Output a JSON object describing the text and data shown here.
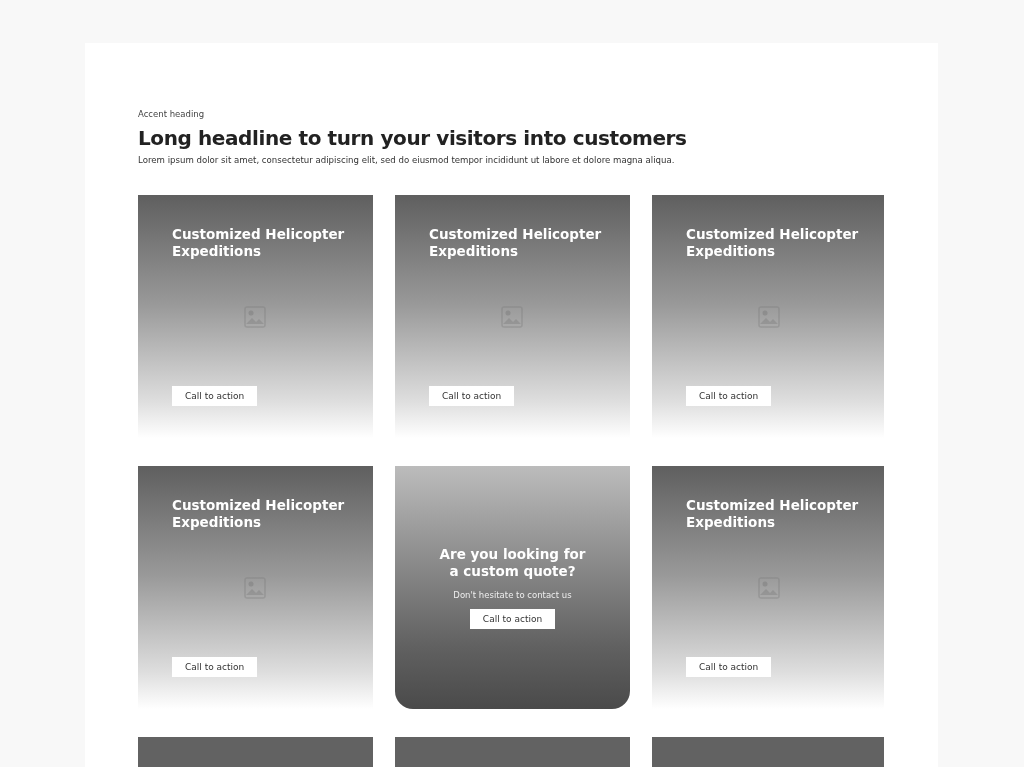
{
  "section": {
    "eyebrow": "Accent heading",
    "headline": "Long headline to turn your visitors into customers",
    "lead": "Lorem ipsum dolor sit amet, consectetur adipiscing elit, sed do eiusmod tempor incididunt ut labore et dolore magna aliqua."
  },
  "cards": [
    {
      "kind": "feature",
      "title": "Customized Helicopter Expeditions",
      "button": "Call to action"
    },
    {
      "kind": "feature",
      "title": "Customized Helicopter Expeditions",
      "button": "Call to action"
    },
    {
      "kind": "feature",
      "title": "Customized Helicopter Expeditions",
      "button": "Call to action"
    },
    {
      "kind": "feature",
      "title": "Customized Helicopter Expeditions",
      "button": "Call to action"
    },
    {
      "kind": "quote",
      "title": "Are you looking for a custom quote?",
      "text": "Don't hesitate to contact us",
      "button": "Call to action"
    },
    {
      "kind": "feature",
      "title": "Customized Helicopter Expeditions",
      "button": "Call to action"
    },
    {
      "kind": "partial"
    },
    {
      "kind": "partial"
    },
    {
      "kind": "partial"
    }
  ]
}
